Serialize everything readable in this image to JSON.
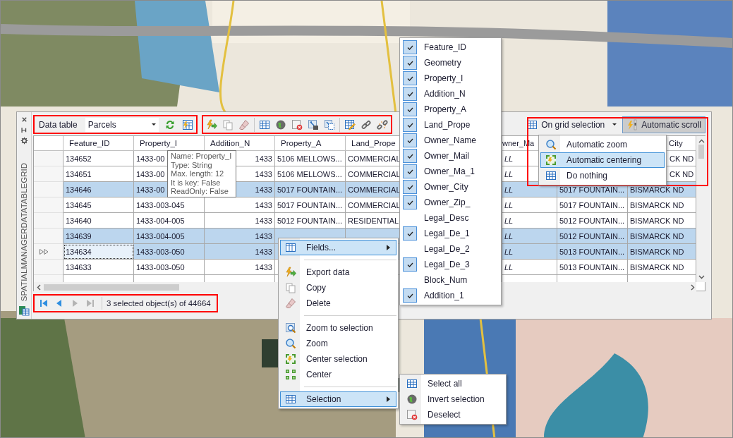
{
  "panel": {
    "side_title": "SPATIALMANAGERDATATABLEGRID",
    "toolbar": {
      "label": "Data table",
      "table_select": "Parcels"
    },
    "grid_options": {
      "label": "On grid selection",
      "auto_scroll": {
        "label": "Automatic scroll",
        "on": true
      }
    },
    "table": {
      "columns": [
        {
          "label": "Feature_ID",
          "kind": "text"
        },
        {
          "label": "Property_I",
          "kind": "text"
        },
        {
          "label": "Addition_N",
          "kind": "number"
        },
        {
          "label": "Property_A",
          "kind": "text"
        },
        {
          "label": "Land_Prope",
          "kind": "text"
        },
        null,
        {
          "label": "wner_Ma",
          "kind": "null"
        },
        {
          "kind": "text"
        },
        {
          "label": "City",
          "kind": "text",
          "clipped": true
        }
      ],
      "rows": [
        {
          "selected": false,
          "current": false,
          "cells": [
            "134652",
            "1433-00",
            "1433",
            "5106 MELLOWS...",
            "COMMERCIAL",
            null,
            "LL",
            null,
            {
              "text": "CK ND",
              "clipped": true
            }
          ]
        },
        {
          "selected": false,
          "current": false,
          "cells": [
            "134651",
            "1433-00",
            "1433",
            "5106 MELLOWS...",
            "COMMERCIAL",
            null,
            "LL",
            null,
            {
              "text": "CK ND",
              "clipped": true
            }
          ]
        },
        {
          "selected": true,
          "current": false,
          "cells": [
            "134646",
            "1433-00",
            "1433",
            "5017 FOUNTAIN...",
            "COMMERCIAL",
            null,
            "LL",
            "5017 FOUNTAIN...",
            "BISMARCK ND"
          ]
        },
        {
          "selected": false,
          "current": false,
          "cells": [
            "134645",
            "1433-003-045",
            "1433",
            "5017 FOUNTAIN...",
            "COMMERCIAL",
            null,
            "LL",
            "5017 FOUNTAIN...",
            "BISMARCK ND"
          ]
        },
        {
          "selected": false,
          "current": false,
          "cells": [
            "134640",
            "1433-004-005",
            "1433",
            "5012 FOUNTAIN...",
            "RESIDENTIAL",
            null,
            "LL",
            "5012 FOUNTAIN...",
            "BISMARCK ND"
          ]
        },
        {
          "selected": true,
          "current": false,
          "cells": [
            "134639",
            "1433-004-005",
            "1433",
            null,
            null,
            null,
            "LL",
            "5012 FOUNTAIN...",
            "BISMARCK ND"
          ]
        },
        {
          "selected": true,
          "current": true,
          "cells": [
            "134634",
            "1433-003-050",
            "1433",
            null,
            null,
            null,
            "LL",
            "5013 FOUNTAIN...",
            "BISMARCK ND"
          ]
        },
        {
          "selected": false,
          "current": false,
          "cells": [
            "134633",
            "1433-003-050",
            "1433",
            null,
            null,
            null,
            "LL",
            "5013 FOUNTAIN...",
            "BISMARCK ND"
          ]
        }
      ]
    },
    "pager": [
      {
        "disabled": false
      },
      {
        "disabled": false
      },
      {
        "disabled": true
      },
      {
        "disabled": true
      }
    ],
    "status": "3 selected object(s) of 44664"
  },
  "tooltip": {
    "lines": [
      "Name: Property_I",
      "Type: String",
      "Max. length: 12",
      "It is key: False",
      "ReadOnly: False"
    ]
  },
  "context_menu": {
    "items": [
      {
        "kind": "item",
        "label": "Fields...",
        "submenu": true,
        "selected": true
      },
      {
        "kind": "separator"
      },
      {
        "kind": "item",
        "label": "Export data",
        "submenu": false,
        "selected": false
      },
      {
        "kind": "item",
        "label": "Copy",
        "submenu": false,
        "selected": false
      },
      {
        "kind": "item",
        "label": "Delete",
        "submenu": false,
        "selected": false
      },
      {
        "kind": "separator"
      },
      {
        "kind": "item",
        "label": "Zoom to selection",
        "submenu": false,
        "selected": false
      },
      {
        "kind": "item",
        "label": "Zoom",
        "submenu": false,
        "selected": false
      },
      {
        "kind": "item",
        "label": "Center selection",
        "submenu": false,
        "selected": false
      },
      {
        "kind": "item",
        "label": "Center",
        "submenu": false,
        "selected": false
      },
      {
        "kind": "separator"
      },
      {
        "kind": "item",
        "label": "Selection",
        "submenu": true,
        "selected": true
      }
    ]
  },
  "fields_menu": {
    "items": [
      {
        "label": "Feature_ID",
        "checked": true
      },
      {
        "label": "Geometry",
        "checked": true
      },
      {
        "label": "Property_I",
        "checked": true
      },
      {
        "label": "Addition_N",
        "checked": true
      },
      {
        "label": "Property_A",
        "checked": true
      },
      {
        "label": "Land_Prope",
        "checked": true
      },
      {
        "label": "Owner_Name",
        "checked": true
      },
      {
        "label": "Owner_Mail",
        "checked": true
      },
      {
        "label": "Owner_Ma_1",
        "checked": true
      },
      {
        "label": "Owner_City",
        "checked": true
      },
      {
        "label": "Owner_Zip_",
        "checked": true
      },
      {
        "label": "Legal_Desc",
        "checked": false
      },
      {
        "label": "Legal_De_1",
        "checked": true
      },
      {
        "label": "Legal_De_2",
        "checked": false
      },
      {
        "label": "Legal_De_3",
        "checked": true
      },
      {
        "label": "Block_Num",
        "checked": false
      },
      {
        "label": "Addition_1",
        "checked": true
      }
    ]
  },
  "selection_menu": {
    "items": [
      {
        "label": "Select all"
      },
      {
        "label": "Invert selection"
      },
      {
        "label": "Deselect"
      }
    ]
  },
  "grid_selection_menu": {
    "items": [
      {
        "label": "Automatic zoom",
        "selected": false
      },
      {
        "label": "Automatic centering",
        "selected": true
      },
      {
        "label": "Do nothing",
        "selected": false
      }
    ]
  }
}
